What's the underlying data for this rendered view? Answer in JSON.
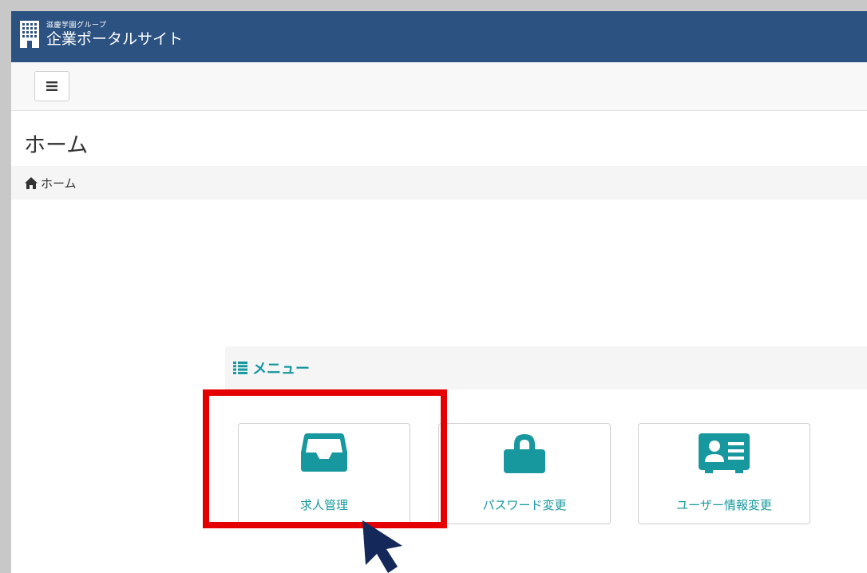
{
  "header": {
    "brand_sub": "滋慶学園グループ",
    "brand_title": "企業ポータルサイト",
    "brand_icon": "building-icon",
    "bg_color": "#2c5282"
  },
  "toolbar": {
    "menu_toggle_icon": "hamburger-icon"
  },
  "page": {
    "title": "ホーム"
  },
  "breadcrumb": {
    "home_icon": "home-icon",
    "label": "ホーム"
  },
  "menu": {
    "title": "メニュー",
    "title_icon": "list-icon",
    "accent_color": "#16989e",
    "tiles": [
      {
        "label": "求人管理",
        "icon": "inbox-icon"
      },
      {
        "label": "パスワード変更",
        "icon": "lock-icon"
      },
      {
        "label": "ユーザー情報変更",
        "icon": "id-card-icon"
      }
    ]
  },
  "annotation": {
    "highlight_color": "#e50000",
    "pointer_icon": "mouse-pointer-icon",
    "pointer_color": "#14285a"
  }
}
